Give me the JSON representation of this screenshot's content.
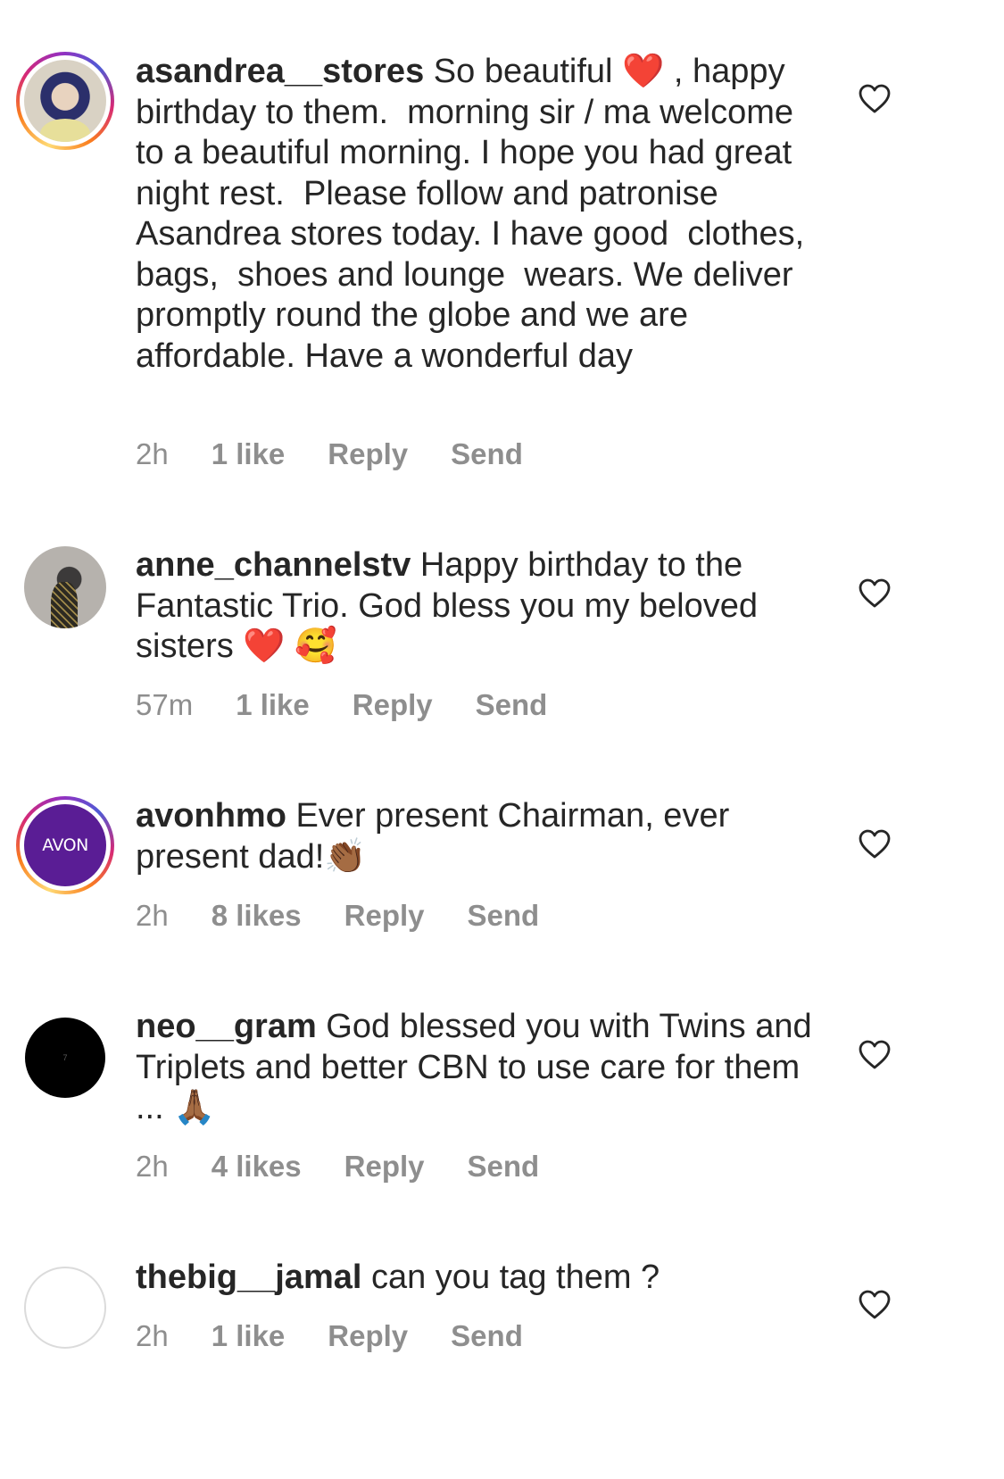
{
  "comments": [
    {
      "username": "asandrea__stores",
      "text": " So beautiful ❤️ , happy birthday to them.  morning sir / ma welcome to a beautiful morning. I hope you had great night rest.  Please follow and patronise Asandrea stores today. I have good  clothes, bags,  shoes and lounge  wears. We deliver promptly round the globe and we are affordable. Have a wonderful day",
      "time": "2h",
      "likes": "1 like",
      "reply": "Reply",
      "send": "Send"
    },
    {
      "username": "anne_channelstv",
      "text": " Happy birthday to the Fantastic Trio. God bless you my beloved sisters ❤️ 🥰",
      "time": "57m",
      "likes": "1 like",
      "reply": "Reply",
      "send": "Send"
    },
    {
      "username": "avonhmo",
      "text": " Ever present Chairman, ever present dad!👏🏾",
      "avatar_text": "AVON",
      "time": "2h",
      "likes": "8 likes",
      "reply": "Reply",
      "send": "Send"
    },
    {
      "username": "neo__gram",
      "text": " God blessed you with Twins and Triplets and better CBN to use care for them ... 🙏🏾",
      "avatar_text": "7",
      "time": "2h",
      "likes": "4 likes",
      "reply": "Reply",
      "send": "Send"
    },
    {
      "username": "thebig__jamal",
      "text": " can you tag them ?",
      "time": "2h",
      "likes": "1 like",
      "reply": "Reply",
      "send": "Send"
    }
  ],
  "icons": {
    "heart": "heart-outline-icon"
  },
  "colors": {
    "text": "#262626",
    "meta": "#8e8e8e",
    "avon_purple": "#5a1d95"
  }
}
